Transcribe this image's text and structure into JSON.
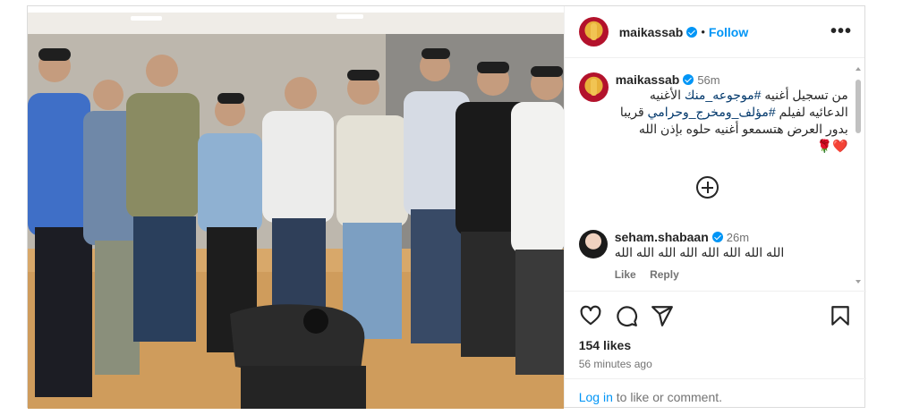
{
  "post": {
    "author": "maikassab",
    "follow_label": "Follow",
    "dot": "•",
    "more_label": "•••"
  },
  "caption": {
    "author": "maikassab",
    "time": "56m",
    "line1": "من تسجيل أغنيه",
    "tag1": "#موجوعه_منك",
    "line1b": "الأغنيه",
    "line2a": "الدعائيه لفيلم",
    "tag2": "#مؤلف_ومخرج_وحرامي",
    "line2b": "قريبا",
    "line3": "بدور العرض هتسمعو أغنيه حلوه بإذن الله",
    "emoji": "❤️🌹"
  },
  "comment": {
    "author": "seham.shabaan",
    "time": "26m",
    "text": "الله الله الله الله الله الله الله الله",
    "like_label": "Like",
    "reply_label": "Reply"
  },
  "stats": {
    "likes": "154 likes",
    "time_ago": "56 minutes ago"
  },
  "login": {
    "link": "Log in",
    "rest": " to like or comment."
  },
  "icons": [
    "heart-icon",
    "comment-icon",
    "share-icon",
    "bookmark-icon",
    "more-options-icon",
    "add-comment-icon",
    "verified-badge-icon"
  ],
  "colors": {
    "link": "#0095f6",
    "tag": "#00376b",
    "muted": "#737373"
  }
}
